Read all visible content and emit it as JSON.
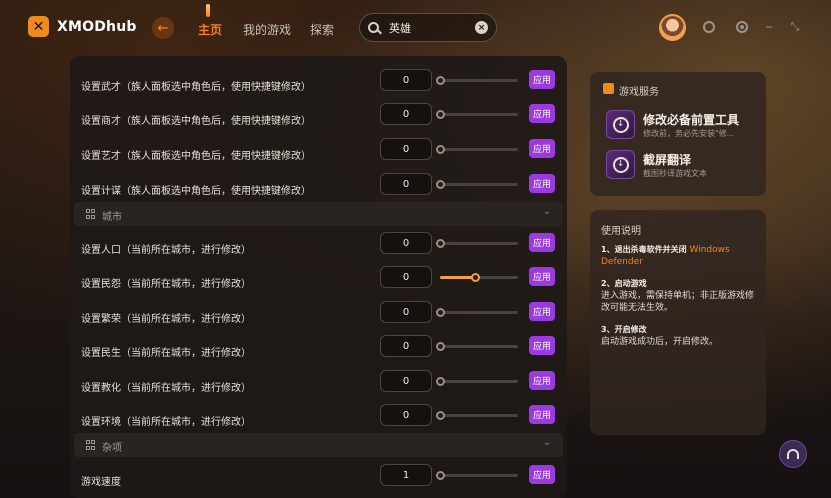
{
  "app": {
    "logo_text": "XMODhub"
  },
  "nav": {
    "items": [
      {
        "label": "主页",
        "active": true
      },
      {
        "label": "我的游戏",
        "active": false
      },
      {
        "label": "探索",
        "active": false
      }
    ]
  },
  "search": {
    "value": "英雄"
  },
  "header_icons": [
    "avatar",
    "ring-icon",
    "target-icon",
    "minimize-icon",
    "collapse-icon"
  ],
  "colors": {
    "accent": "#ff7a1a",
    "apply_button": "#9a3ae0",
    "slider_fill": "#f0a040"
  },
  "apply_label": "应用",
  "sections": [
    {
      "title": "",
      "rows": [
        {
          "label": "设置武才（族人面板选中角色后，使用快捷键修改）",
          "value": "0",
          "slider_fraction": 0
        },
        {
          "label": "设置商才（族人面板选中角色后，使用快捷键修改）",
          "value": "0",
          "slider_fraction": 0
        },
        {
          "label": "设置艺才（族人面板选中角色后，使用快捷键修改）",
          "value": "0",
          "slider_fraction": 0
        },
        {
          "label": "设置计谋（族人面板选中角色后，使用快捷键修改）",
          "value": "0",
          "slider_fraction": 0
        }
      ]
    },
    {
      "title": "城市",
      "rows": [
        {
          "label": "设置人口（当前所在城市，进行修改）",
          "value": "0",
          "slider_fraction": 0
        },
        {
          "label": "设置民怨（当前所在城市，进行修改）",
          "value": "0",
          "slider_fraction": 0.45
        },
        {
          "label": "设置繁荣（当前所在城市，进行修改）",
          "value": "0",
          "slider_fraction": 0
        },
        {
          "label": "设置民生（当前所在城市，进行修改）",
          "value": "0",
          "slider_fraction": 0
        },
        {
          "label": "设置教化（当前所在城市，进行修改）",
          "value": "0",
          "slider_fraction": 0
        },
        {
          "label": "设置环境（当前所在城市，进行修改）",
          "value": "0",
          "slider_fraction": 0
        }
      ]
    },
    {
      "title": "杂项",
      "rows": [
        {
          "label": "游戏速度",
          "value": "1",
          "slider_fraction": 0
        }
      ]
    }
  ],
  "game_services": {
    "title": "游戏服务",
    "items": [
      {
        "title": "修改必备前置工具",
        "desc": "修改前，务必先安装\"修..."
      },
      {
        "title": "截屏翻译",
        "desc": "截图秒译游戏文本"
      }
    ]
  },
  "guide": {
    "title": "使用说明",
    "steps": [
      {
        "heading": "1、退出杀毒软件并关闭",
        "highlight": "Windows Defender",
        "body": ""
      },
      {
        "heading": "2、启动游戏",
        "highlight": "",
        "body": "进入游戏，需保持单机；非正版游戏修改可能无法生效。"
      },
      {
        "heading": "3、开启修改",
        "highlight": "",
        "body": "启动游戏成功后，开启修改。"
      }
    ]
  }
}
